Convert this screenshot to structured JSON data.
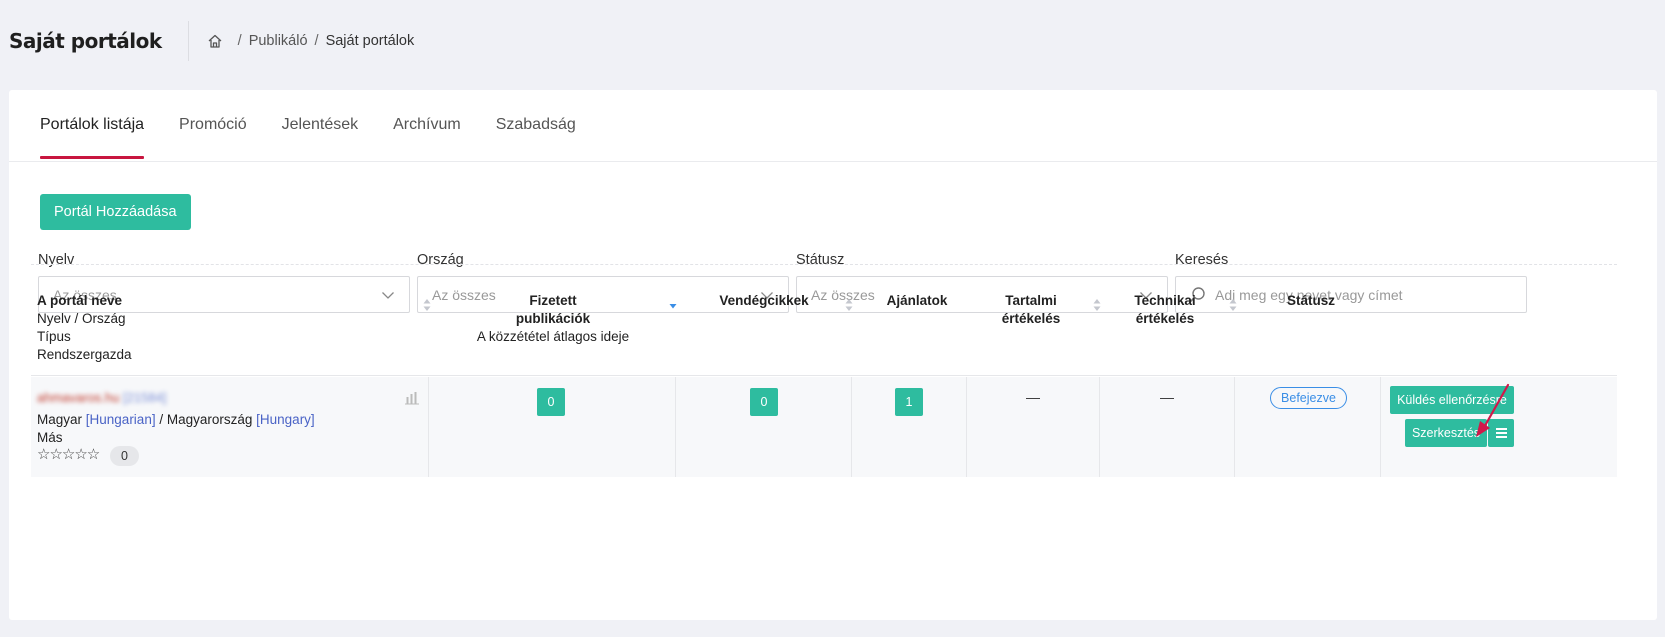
{
  "header": {
    "title": "Saját portálok",
    "breadcrumb": {
      "parent": "Publikáló",
      "current": "Saját portálok",
      "separator": "/"
    }
  },
  "tabs": [
    {
      "label": "Portálok listája",
      "active": true
    },
    {
      "label": "Promóció",
      "active": false
    },
    {
      "label": "Jelentések",
      "active": false
    },
    {
      "label": "Archívum",
      "active": false
    },
    {
      "label": "Szabadság",
      "active": false
    }
  ],
  "add_button": "Portál Hozzáadása",
  "filters": {
    "language": {
      "label": "Nyelv",
      "value": "Az összes"
    },
    "country": {
      "label": "Ország",
      "value": "Az összes"
    },
    "status": {
      "label": "Státusz",
      "value": "Az összes"
    },
    "search": {
      "label": "Keresés",
      "placeholder": "Adj meg egy nevet vagy címet"
    }
  },
  "table": {
    "headers": {
      "name": {
        "line1": "A portál neve",
        "line2": "Nyelv / Ország",
        "line3": "Típus",
        "line4": "Rendszergazda"
      },
      "paid": {
        "line1": "Fizetett",
        "line2": "publikációk",
        "line3": "A közzététel átlagos ideje"
      },
      "guest": "Vendégcikkek",
      "offers": "Ajánlatok",
      "content": {
        "line1": "Tartalmi",
        "line2": "értékelés"
      },
      "technical": {
        "line1": "Technikai",
        "line2": "értékelés"
      },
      "status": "Státusz"
    },
    "rows": [
      {
        "name": "ahmavaros.hu",
        "name_id": "[21584]",
        "language": "Magyar",
        "language_en": "[Hungarian]",
        "country": "Magyarország",
        "country_en": "[Hungary]",
        "type": "Más",
        "rating_count": "0",
        "stars": "☆☆☆☆☆",
        "paid": "0",
        "guest": "0",
        "offers": "1",
        "content_rating": "—",
        "technical_rating": "—",
        "status": "Befejezve",
        "actions": {
          "send": "Küldés ellenőrzésre",
          "edit": "Szerkesztés"
        }
      }
    ]
  },
  "colors": {
    "accent": "#2ebc9f",
    "tab_underline": "#c8163f",
    "status_blue": "#3a8ee6",
    "arrow": "#d1184a"
  },
  "icons": [
    "home-icon",
    "chevron-down-icon",
    "search-icon",
    "sort-icon",
    "bar-chart-icon",
    "hamburger-icon",
    "red-arrow-annotation"
  ]
}
